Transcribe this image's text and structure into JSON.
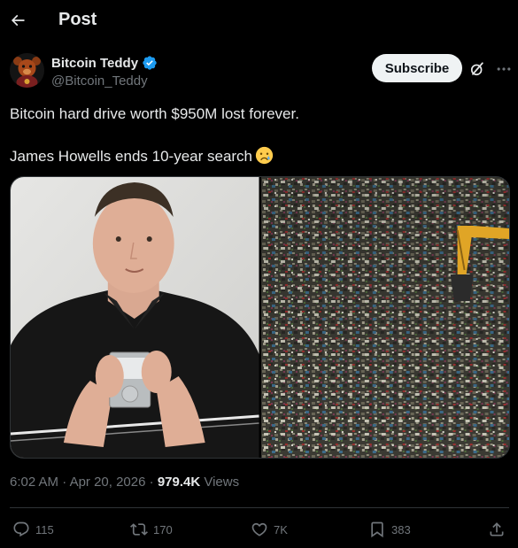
{
  "header": {
    "title": "Post"
  },
  "author": {
    "display_name": "Bitcoin Teddy",
    "handle": "@Bitcoin_Teddy",
    "verified": true
  },
  "subscribe_label": "Subscribe",
  "post": {
    "line1": "Bitcoin hard drive worth $950M lost forever.",
    "line2": "James Howells ends 10-year search",
    "emoji": "crying-face"
  },
  "meta": {
    "time": "6:02 AM",
    "separator1": "·",
    "date": "Apr 20, 2026",
    "separator2": "·",
    "views_count": "979.4K",
    "views_label": "Views"
  },
  "actions": {
    "replies": "115",
    "reposts": "170",
    "likes": "7K",
    "bookmarks": "383"
  },
  "colors": {
    "background": "#000000",
    "text": "#e7e9ea",
    "muted": "#71767b",
    "verified": "#1d9bf0",
    "border": "#2f3336"
  }
}
